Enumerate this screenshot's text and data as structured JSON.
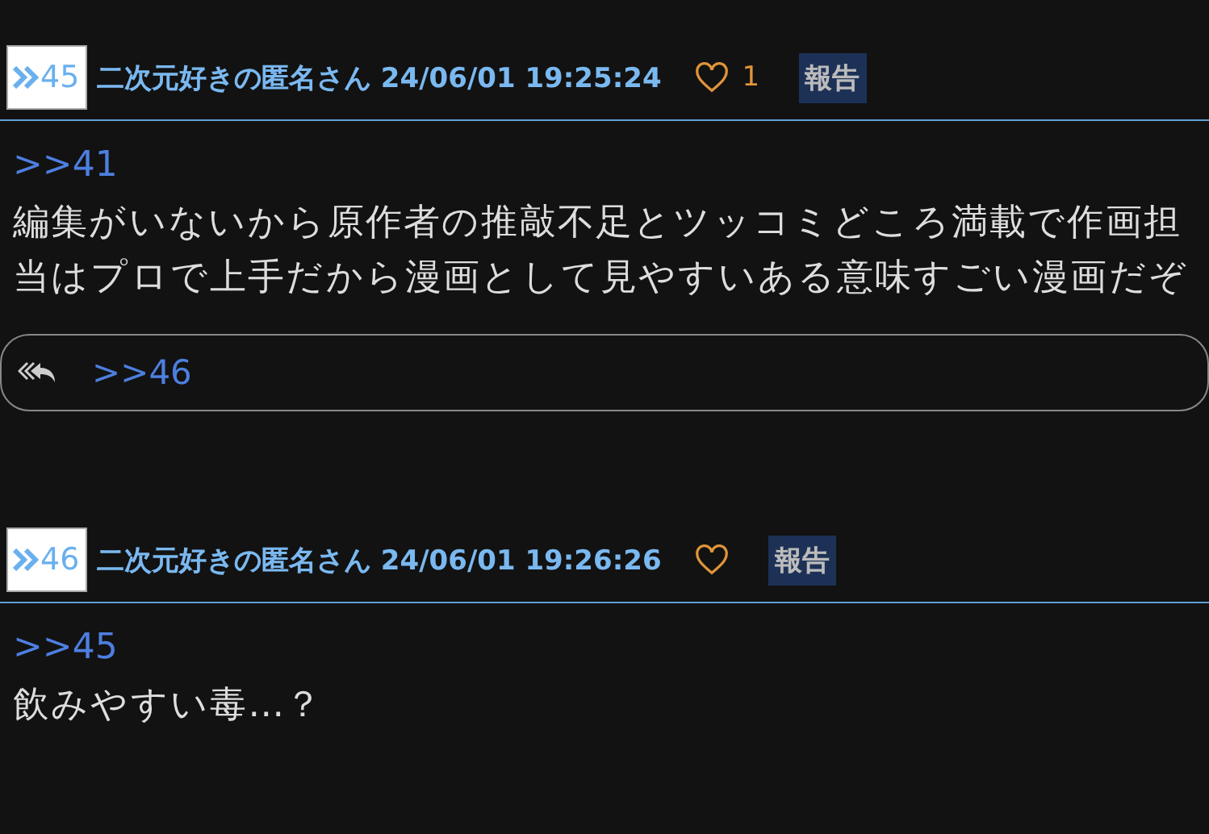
{
  "posts": [
    {
      "number": "45",
      "author": "二次元好きの匿名さん",
      "datetime": "24/06/01 19:25:24",
      "like_count": "1",
      "report": "報告",
      "reply_to": ">>41",
      "body": "編集がいないから原作者の推敲不足とツッコミどころ満載で作画担当はプロで上手だから漫画として見やすいある意味すごい漫画だぞ",
      "replies": [
        ">>46"
      ]
    },
    {
      "number": "46",
      "author": "二次元好きの匿名さん",
      "datetime": "24/06/01 19:26:26",
      "report": "報告",
      "reply_to": ">>45",
      "body": "飲みやすい毒…？"
    }
  ]
}
